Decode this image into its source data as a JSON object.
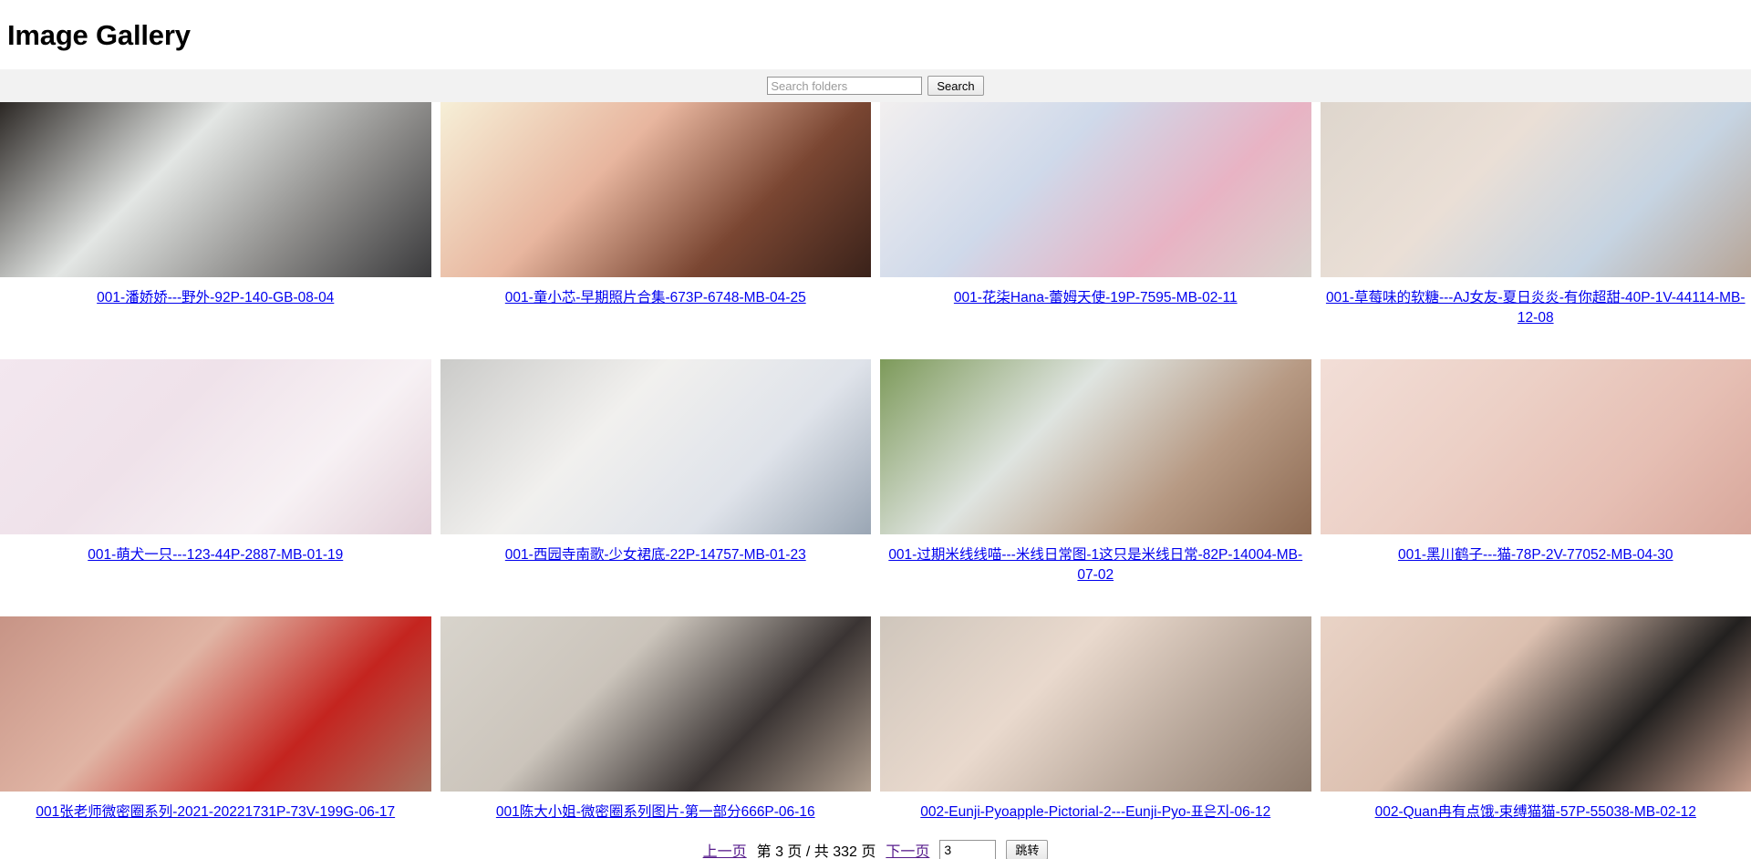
{
  "page_title": "Image Gallery",
  "search": {
    "placeholder": "Search folders",
    "value": "",
    "button_label": "Search"
  },
  "gallery": {
    "items": [
      {
        "caption": "001-潘娇娇---野外-92P-140-GB-08-04",
        "colors": [
          "#2b2724",
          "#e3e6e4",
          "#8d8c8a",
          "#3a3a3c"
        ]
      },
      {
        "caption": "001-童小芯-早期照片合集-673P-6748-MB-04-25",
        "colors": [
          "#f6efd7",
          "#e8b69f",
          "#7a4632",
          "#3a221a"
        ]
      },
      {
        "caption": "001-花柒Hana-蕾姆天使-19P-7595-MB-02-11",
        "colors": [
          "#f2efef",
          "#cfd9ea",
          "#e8b3c4",
          "#d9d3cd"
        ]
      },
      {
        "caption": "001-草莓味的软糖---AJ女友-夏日炎炎-有你超甜-40P-1V-44114-MB-12-08",
        "colors": [
          "#ded6cd",
          "#eadfd6",
          "#c6d4e2",
          "#b7a597"
        ]
      },
      {
        "caption": "001-萌犬一只---123-44P-2887-MB-01-19",
        "colors": [
          "#f3e7ef",
          "#efe2ea",
          "#f7f1f4",
          "#e2cfd8"
        ]
      },
      {
        "caption": "001-西园寺南歌-少女裙底-22P-14757-MB-01-23",
        "colors": [
          "#cbcbc9",
          "#f1f0ee",
          "#dfe3ea",
          "#9aa6b4"
        ]
      },
      {
        "caption": "001-过期米线线喵---米线日常图-1这只是米线日常-82P-14004-MB-07-02",
        "colors": [
          "#7d9a5a",
          "#dfe4e0",
          "#b79a84",
          "#8d6a52"
        ]
      },
      {
        "caption": "001-黑川鹤子---猫-78P-2V-77052-MB-04-30",
        "colors": [
          "#f2ded7",
          "#ecd0c6",
          "#e6bfb4",
          "#d8a79b"
        ]
      },
      {
        "caption": "001张老师微密圈系列-2021-20221731P-73V-199G-06-17",
        "colors": [
          "#c79486",
          "#e0b4a4",
          "#c4241f",
          "#a8715f"
        ]
      },
      {
        "caption": "001陈大小姐-微密圈系列图片-第一部分666P-06-16",
        "colors": [
          "#d8d4cc",
          "#cbc4bb",
          "#3a3433",
          "#b09f90"
        ]
      },
      {
        "caption": "002-Eunji-Pyoapple-Pictorial-2---Eunji-Pyo-표은지-06-12",
        "colors": [
          "#cfc6bc",
          "#e9d9cd",
          "#b8a79a",
          "#8d7a6c"
        ]
      },
      {
        "caption": "002-Quan冉有点饿-束缚猫猫-57P-55038-MB-02-12",
        "colors": [
          "#e9d3c6",
          "#dcc0b0",
          "#22201f",
          "#c59d8c"
        ]
      }
    ]
  },
  "pagination": {
    "prev_label": "上一页",
    "status": "第 3 页 / 共 332 页",
    "next_label": "下一页",
    "jump_value": "3",
    "jump_button_label": "跳转"
  }
}
